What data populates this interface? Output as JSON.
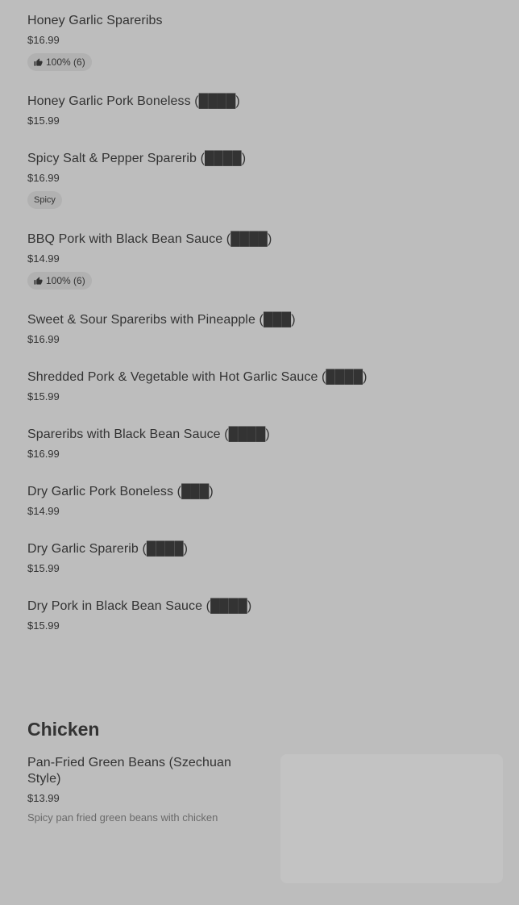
{
  "menu": {
    "items": [
      {
        "name": "Honey Garlic Spareribs",
        "price": "$16.99",
        "badge": "100% (6)"
      },
      {
        "name": "Honey Garlic Pork Boneless (████)",
        "price": "$15.99"
      },
      {
        "name": "Spicy Salt & Pepper Sparerib (████)",
        "price": "$16.99",
        "tag": "Spicy"
      },
      {
        "name": "BBQ Pork with Black Bean Sauce (████)",
        "price": "$14.99",
        "badge": "100% (6)"
      },
      {
        "name": "Sweet & Sour Spareribs with Pineapple (███)",
        "price": "$16.99"
      },
      {
        "name": "Shredded Pork & Vegetable with Hot Garlic Sauce (████)",
        "price": "$15.99"
      },
      {
        "name": "Spareribs with Black Bean Sauce (████)",
        "price": "$16.99"
      },
      {
        "name": "Dry Garlic Pork Boneless (███)",
        "price": "$14.99"
      },
      {
        "name": "Dry Garlic Sparerib (████)",
        "price": "$15.99"
      },
      {
        "name": "Dry Pork in Black Bean Sauce (████)",
        "price": "$15.99"
      }
    ]
  },
  "chicken": {
    "title": "Chicken",
    "item": {
      "name": "Pan-Fried Green Beans (Szechuan Style)",
      "price": "$13.99",
      "description": "Spicy pan fried green beans with chicken"
    }
  },
  "icons": {
    "badge_icon": "thumbs-up-icon"
  },
  "colors": {
    "background": "#bdbdbd",
    "badge_bg": "#b1b1b1",
    "image_placeholder": "#c3c3c3"
  }
}
